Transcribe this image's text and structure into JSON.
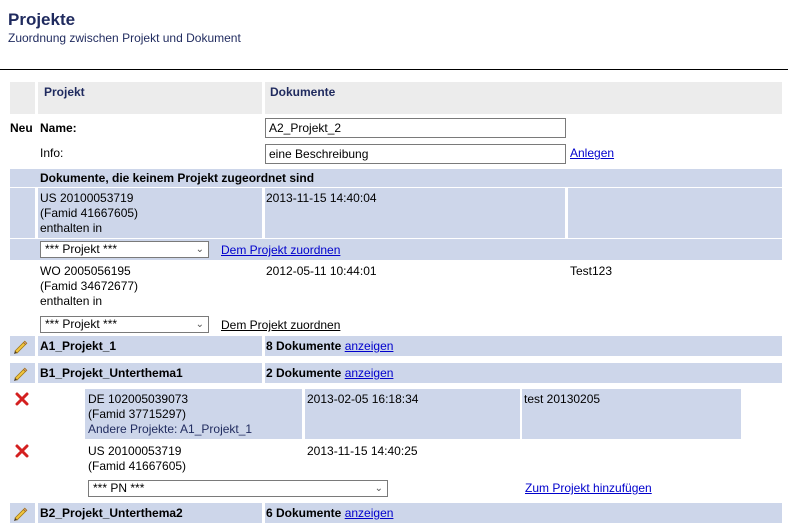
{
  "header": {
    "title": "Projekte",
    "subtitle": "Zuordnung zwischen Projekt und Dokument"
  },
  "table": {
    "col_project": "Projekt",
    "col_documents": "Dokumente"
  },
  "new_project": {
    "neu_label": "Neu",
    "name_label": "Name:",
    "name_value": "A2_Projekt_2",
    "info_label": "Info:",
    "info_value": "eine Beschreibung",
    "create_link": "Anlegen"
  },
  "unassigned": {
    "heading": "Dokumente, die keinem Projekt zugeordnet sind",
    "documents": [
      {
        "number": "US 20100053719",
        "famid": "(Famid 41667605)",
        "contained": "enthalten in",
        "date": "2013-11-15 14:40:04",
        "comment": "",
        "select_value": "*** Projekt ***",
        "assign_link": "Dem Projekt zuordnen"
      },
      {
        "number": "WO 2005056195",
        "famid": "(Famid 34672677)",
        "contained": "enthalten in",
        "date": "2012-05-11 10:44:01",
        "comment": "Test123",
        "select_value": "*** Projekt ***",
        "assign_link": "Dem Projekt zuordnen"
      }
    ]
  },
  "projects": [
    {
      "name": "A1_Projekt_1",
      "count": "8 Dokumente",
      "show_link": "anzeigen"
    },
    {
      "name": "B1_Projekt_Unterthema1",
      "count": "2 Dokumente",
      "show_link": "anzeigen"
    },
    {
      "name": "B2_Projekt_Unterthema2",
      "count": "6 Dokumente",
      "show_link": "anzeigen"
    }
  ],
  "project_documents": [
    {
      "number": "DE 102005039073",
      "famid": "(Famid 37715297)",
      "other_projects": "Andere Projekte: A1_Projekt_1",
      "date": "2013-02-05 16:18:34",
      "comment": "test 20130205"
    },
    {
      "number": "US 20100053719",
      "famid": "(Famid 41667605)",
      "date": "2013-11-15 14:40:25",
      "comment": ""
    }
  ],
  "add_document": {
    "select_value": "*** PN ***",
    "add_link": "Zum Projekt hinzufügen"
  },
  "icons": {
    "edit": "pencil-icon",
    "remove": "red-x-icon",
    "dropdown": "chevron-down-icon"
  },
  "colors": {
    "heading": "#1f2a5e",
    "row_blue": "#cdd6ea",
    "header_gray": "#ececec",
    "link": "#0000cc",
    "delete_red": "#d42020"
  }
}
